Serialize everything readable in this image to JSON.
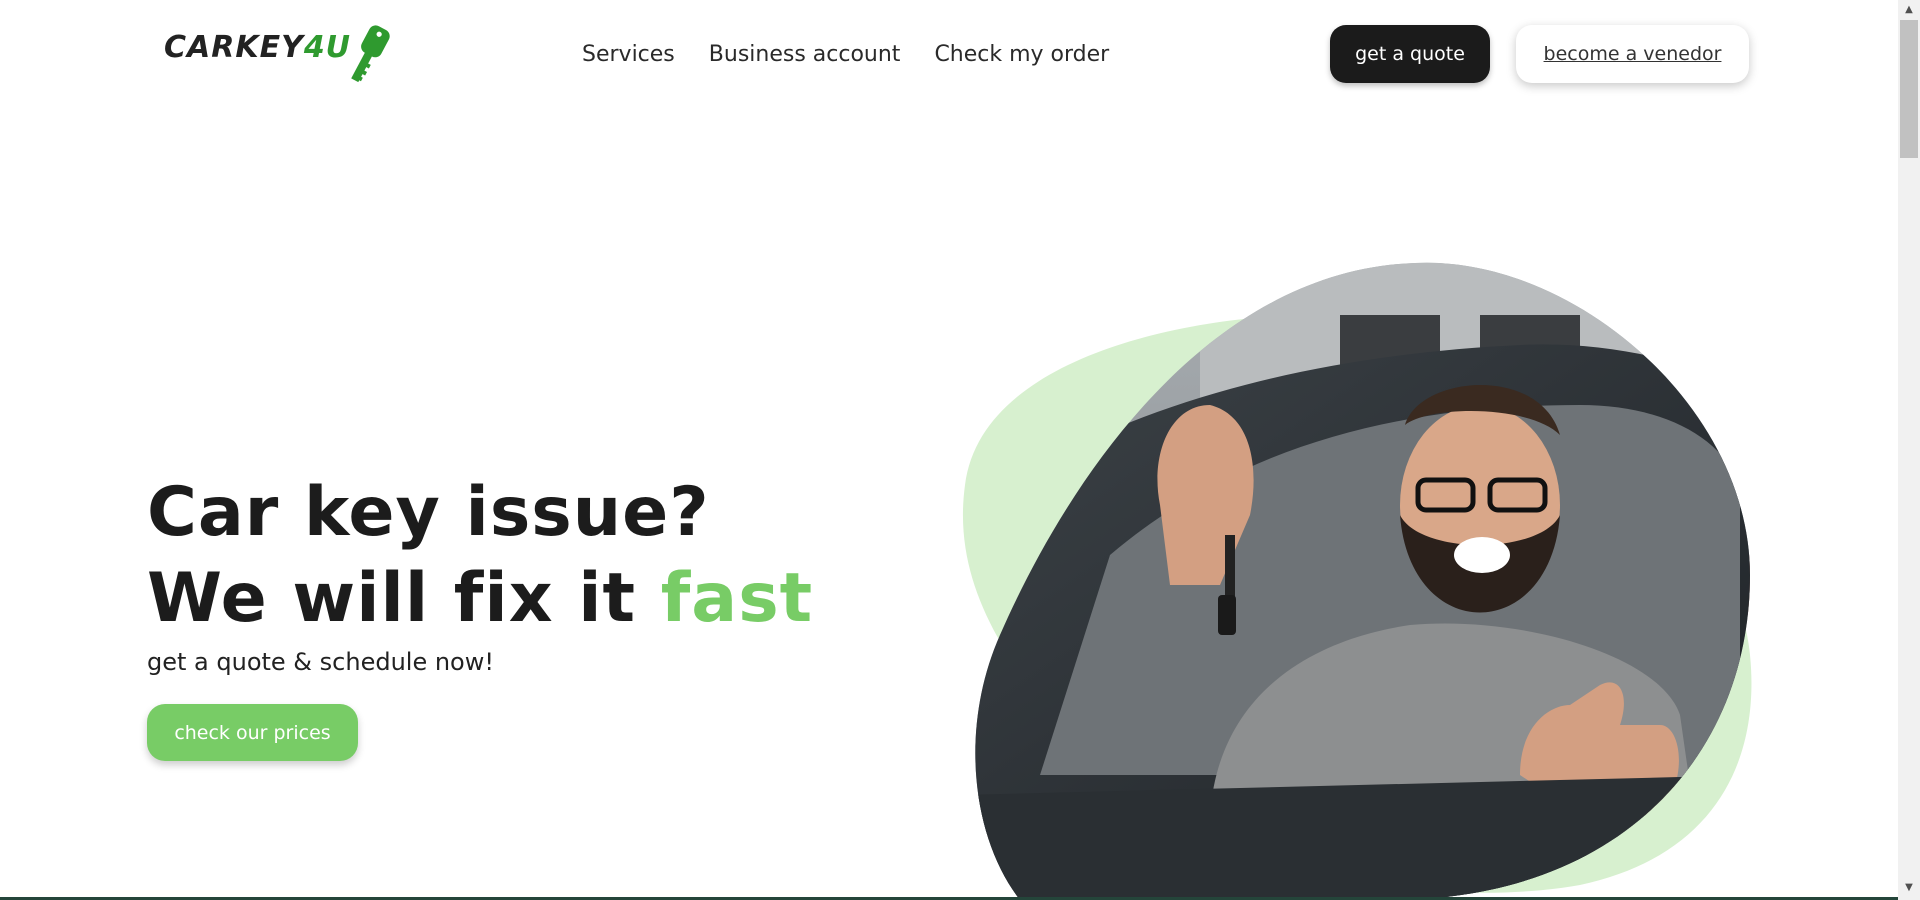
{
  "header": {
    "logo": {
      "text_main": "CARKEY",
      "text_accent": "4U",
      "icon": "car-key-icon"
    },
    "nav": [
      {
        "label": "Services"
      },
      {
        "label": "Business account"
      },
      {
        "label": "Check my order"
      }
    ],
    "quote_button": "get a quote",
    "vendor_button": "become a venedor"
  },
  "hero": {
    "title_line1": "Car key issue?",
    "title_line2_prefix": "We will fix it ",
    "title_line2_highlight": "fast",
    "subtitle": "get a quote & schedule now!",
    "cta_button": "check our prices",
    "image": "smiling-man-in-car-holding-keys"
  },
  "colors": {
    "accent_green": "#78cc66",
    "light_green_blob": "#d7f0cf",
    "dark_button": "#1b1b1b",
    "logo_green": "#2f9a2f"
  },
  "scrollbar": {
    "up_arrow": "▲",
    "down_arrow": "▼"
  }
}
